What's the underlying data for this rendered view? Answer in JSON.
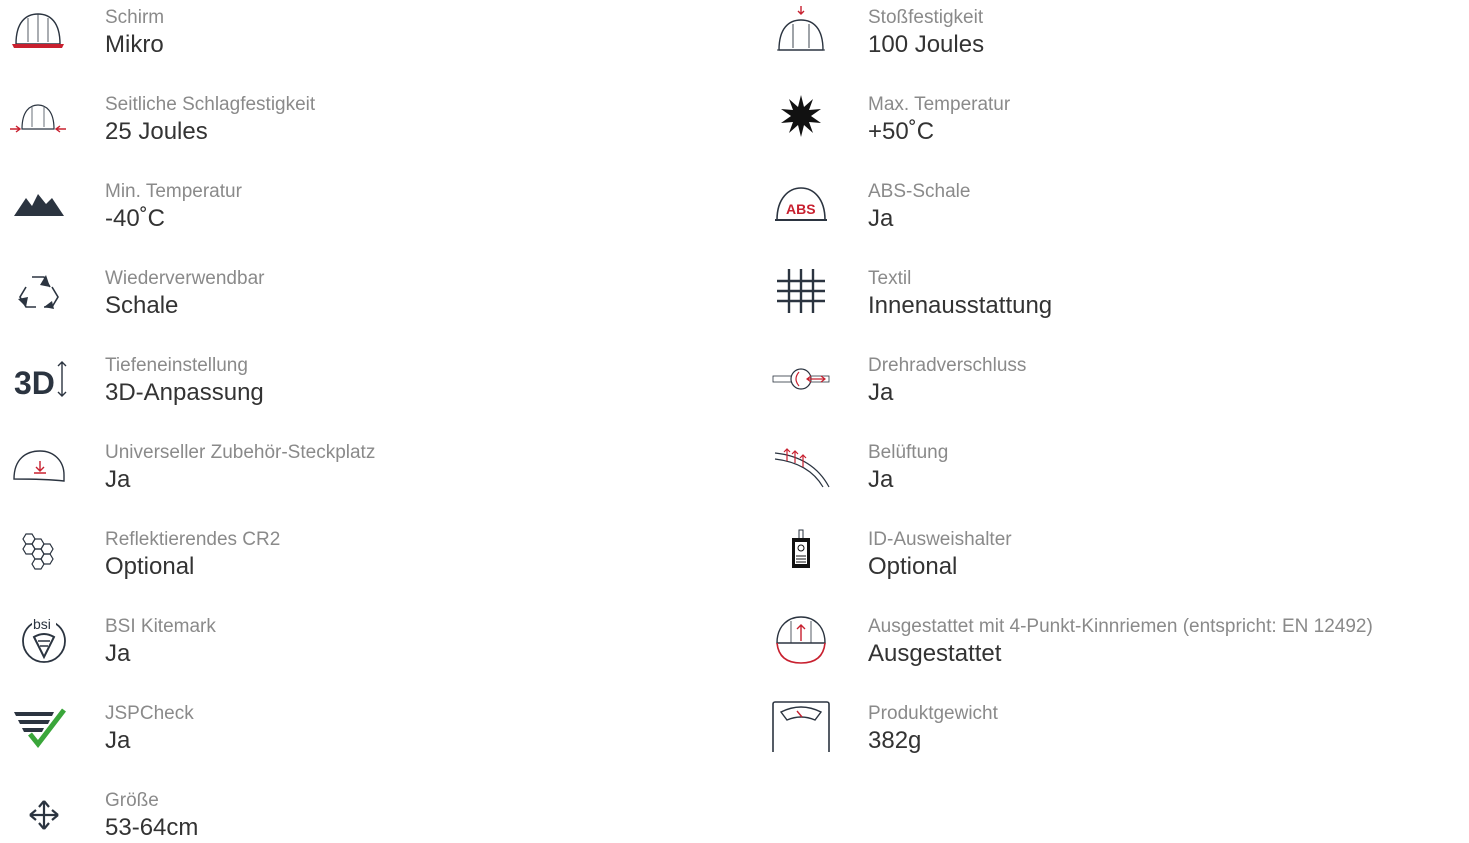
{
  "left": [
    {
      "icon": "helmet-brim-icon",
      "label": "Schirm",
      "value": "Mikro"
    },
    {
      "icon": "side-impact-icon",
      "label": "Seitliche Schlagfestigkeit",
      "value": "25 Joules"
    },
    {
      "icon": "mountains-icon",
      "label": "Min. Temperatur",
      "value": "-40˚C"
    },
    {
      "icon": "recycle-icon",
      "label": "Wiederverwendbar",
      "value": "Schale"
    },
    {
      "icon": "3d-adjustment-icon",
      "label": "Tiefeneinstellung",
      "value": "3D-Anpassung"
    },
    {
      "icon": "accessory-slot-icon",
      "label": "Universeller Zubehör-Steckplatz",
      "value": "Ja"
    },
    {
      "icon": "honeycomb-icon",
      "label": "Reflektierendes CR2",
      "value": "Optional"
    },
    {
      "icon": "bsi-kitemark-icon",
      "label": "BSI Kitemark",
      "value": "Ja"
    },
    {
      "icon": "jspcheck-icon",
      "label": "JSPCheck",
      "value": "Ja"
    },
    {
      "icon": "size-arrows-icon",
      "label": "Größe",
      "value": "53-64cm"
    }
  ],
  "right": [
    {
      "icon": "top-impact-icon",
      "label": "Stoßfestigkeit",
      "value": "100 Joules"
    },
    {
      "icon": "sun-icon",
      "label": "Max. Temperatur",
      "value": "+50˚C"
    },
    {
      "icon": "abs-shell-icon",
      "label": "ABS-Schale",
      "value": "Ja",
      "icon_text": "ABS"
    },
    {
      "icon": "textile-icon",
      "label": "Textil",
      "value": "Innenausstattung"
    },
    {
      "icon": "wheel-ratchet-icon",
      "label": "Drehradverschluss",
      "value": "Ja"
    },
    {
      "icon": "ventilation-icon",
      "label": "Belüftung",
      "value": "Ja"
    },
    {
      "icon": "id-badge-icon",
      "label": "ID-Ausweishalter",
      "value": "Optional"
    },
    {
      "icon": "chinstrap-icon",
      "label": "Ausgestattet mit 4-Punkt-Kinnriemen (entspricht: EN 12492)",
      "value": "Ausgestattet"
    },
    {
      "icon": "scale-icon",
      "label": "Produktgewicht",
      "value": "382g"
    }
  ],
  "colors": {
    "label": "#8a8a8a",
    "value": "#333333",
    "accent_red": "#c8202f",
    "icon_dark": "#2b3440",
    "check_green": "#3aa63a"
  }
}
